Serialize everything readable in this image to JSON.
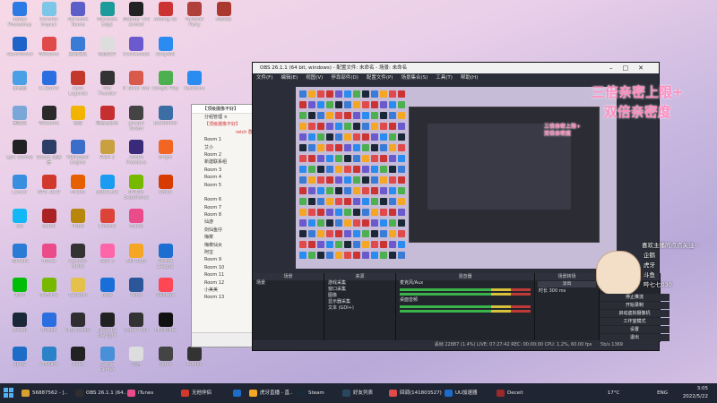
{
  "desktop": {
    "icons": [
      {
        "label": "Adobe Photoshop",
        "color": "#2c7be5"
      },
      {
        "label": "Genshin Impact",
        "color": "#7cc6e8"
      },
      {
        "label": "Microsoft Teams",
        "color": "#5b5fc7"
      },
      {
        "label": "Microsoft Edge",
        "color": "#1d9a9a"
      },
      {
        "label": "Nobody The Armed",
        "color": "#222"
      },
      {
        "label": "Among Us",
        "color": "#c33"
      },
      {
        "label": "Pummel Party",
        "color": "#b0403a"
      },
      {
        "label": "Honkai",
        "color": "#aa3a2f"
      },
      {
        "label": "TeamViewer",
        "color": "#1e64c8"
      },
      {
        "label": "WeGame",
        "color": "#e14a4a"
      },
      {
        "label": "腾讯会议",
        "color": "#3a7bd5"
      },
      {
        "label": "新建文件",
        "color": "#ddd"
      },
      {
        "label": "Overcooked",
        "color": "#6a5acd"
      },
      {
        "label": "DingTalk",
        "color": "#2a8cf0"
      },
      {
        "label": "",
        "color": "transparent"
      },
      {
        "label": "",
        "color": "transparent"
      },
      {
        "label": "此电脑",
        "color": "#4aa0e6"
      },
      {
        "label": "CCleaner",
        "color": "#2a6ee0"
      },
      {
        "label": "Apex Legends",
        "color": "#c0392b"
      },
      {
        "label": "War Thunder",
        "color": "#333"
      },
      {
        "label": "It Takes Two",
        "color": "#d75a4a"
      },
      {
        "label": "Google Play",
        "color": "#4caf50"
      },
      {
        "label": "Kuaishou",
        "color": "#2a8cf0"
      },
      {
        "label": "",
        "color": "transparent"
      },
      {
        "label": "回收站",
        "color": "#7aa7d8"
      },
      {
        "label": "WeGame",
        "color": "#2a2a2a"
      },
      {
        "label": "微信",
        "color": "#f1b400"
      },
      {
        "label": "网易云音乐",
        "color": "#c62f2f"
      },
      {
        "label": "Escape Tarkov",
        "color": "#444"
      },
      {
        "label": "Battlefield",
        "color": "#3a6ea5"
      },
      {
        "label": "",
        "color": "transparent"
      },
      {
        "label": "",
        "color": "transparent"
      },
      {
        "label": "Epic Games",
        "color": "#222"
      },
      {
        "label": "Steam 加速器",
        "color": "#2c3e66"
      },
      {
        "label": "Wallpaper Engine",
        "color": "#3a6ec8"
      },
      {
        "label": "Wish 3",
        "color": "#c8a040"
      },
      {
        "label": "Adobe Premiere",
        "color": "#3a2b7a"
      },
      {
        "label": "Origin",
        "color": "#f26522"
      },
      {
        "label": "",
        "color": "transparent"
      },
      {
        "label": "",
        "color": "transparent"
      },
      {
        "label": "Lancer",
        "color": "#3a8ee0"
      },
      {
        "label": "WPS 2019",
        "color": "#d0392b"
      },
      {
        "label": "Firefox",
        "color": "#e66000"
      },
      {
        "label": "Battle.net",
        "color": "#1a9cf0"
      },
      {
        "label": "NVIDIA Experience",
        "color": "#76b900"
      },
      {
        "label": "Office",
        "color": "#d83b01"
      },
      {
        "label": "",
        "color": "transparent"
      },
      {
        "label": "",
        "color": "transparent"
      },
      {
        "label": "QQ",
        "color": "#12b7f5"
      },
      {
        "label": "Game",
        "color": "#aa2222"
      },
      {
        "label": "PUBG",
        "color": "#b8860b"
      },
      {
        "label": "Chrome",
        "color": "#db4437"
      },
      {
        "label": "iTunes",
        "color": "#ea4c89"
      },
      {
        "label": "",
        "color": "transparent"
      },
      {
        "label": "",
        "color": "transparent"
      },
      {
        "label": "",
        "color": "transparent"
      },
      {
        "label": "Tencent",
        "color": "#2a7bd5"
      },
      {
        "label": "iTunes",
        "color": "#ea4c89"
      },
      {
        "label": "Counter-Strike",
        "color": "#333"
      },
      {
        "label": "osu! 3",
        "color": "#ff66aa"
      },
      {
        "label": "Fall Guys",
        "color": "#f5a623"
      },
      {
        "label": "Rocket League",
        "color": "#1c6fd1"
      },
      {
        "label": "",
        "color": "transparent"
      },
      {
        "label": "",
        "color": "transparent"
      },
      {
        "label": "iQIYI",
        "color": "#00be06"
      },
      {
        "label": "GeForce",
        "color": "#76b900"
      },
      {
        "label": "Genshin",
        "color": "#e4c14a"
      },
      {
        "label": "Tools",
        "color": "#1a6ed8"
      },
      {
        "label": "Word",
        "color": "#2b579a"
      },
      {
        "label": "Valorant",
        "color": "#ff4655"
      },
      {
        "label": "",
        "color": "transparent"
      },
      {
        "label": "",
        "color": "transparent"
      },
      {
        "label": "Steam",
        "color": "#1b2838"
      },
      {
        "label": "Ubisoft",
        "color": "#2a6ee0"
      },
      {
        "label": "OBS Studio",
        "color": "#302e31"
      },
      {
        "label": "Dead by Daylight",
        "color": "#222"
      },
      {
        "label": "Super Wolf",
        "color": "#333"
      },
      {
        "label": "MKOnline",
        "color": "#111"
      },
      {
        "label": "",
        "color": "transparent"
      },
      {
        "label": "",
        "color": "transparent"
      },
      {
        "label": "Uplay",
        "color": "#1d6cc8"
      },
      {
        "label": "VMware",
        "color": "#2a82c8"
      },
      {
        "label": "Geek",
        "color": "#222"
      },
      {
        "label": "Game Center",
        "color": "#4a90d9"
      },
      {
        "label": "文档",
        "color": "#ddd"
      },
      {
        "label": "Video",
        "color": "#444"
      },
      {
        "label": "Roblox",
        "color": "#333"
      },
      {
        "label": "",
        "color": "transparent"
      }
    ]
  },
  "chat": {
    "title": "【顶级摄像不好】",
    "header": "【顶级摄像不好】",
    "room_label": "分组管理 ×",
    "owner": "relch 群",
    "rows": [
      "Room 1",
      "艾小",
      "Room 2",
      "新建联系组",
      "Room 3",
      "Room 4",
      "Room 5",
      "",
      "Room 6",
      "Room 7",
      "Room 8",
      "仙游",
      "剑仙鱼仔",
      "梅菜",
      "梅菜仙女",
      "阿宝",
      "Room 9",
      "Room 10",
      "Room 11",
      "Room 12",
      "小美美",
      "Room 13"
    ]
  },
  "obs": {
    "title": "OBS 26.1.1 (64 bit, windows) - 配置文件: 未命名 - 场景: 未命名",
    "menu": [
      "文件(F)",
      "编辑(E)",
      "视图(V)",
      "停靠部件(D)",
      "配置文件(P)",
      "场景集合(S)",
      "工具(T)",
      "帮助(H)"
    ],
    "docks": {
      "scenes": {
        "header": "场景",
        "items": [
          "场景"
        ]
      },
      "sources": {
        "header": "来源",
        "items": [
          "游戏采集",
          "窗口采集",
          "图像",
          "显示器采集",
          "文本 (GDI+)"
        ]
      },
      "mixer": {
        "header": "混音器",
        "items": [
          "麦克风/Aux",
          "桌面音频"
        ],
        "levels": [
          "0.0 dB",
          "0.0 dB"
        ]
      },
      "transitions": {
        "header": "场景转场",
        "type": "淡出",
        "duration_label": "时长",
        "duration": "300 ms"
      },
      "controls": {
        "header": "控件",
        "buttons": [
          "停止推流",
          "开始录制",
          "启动虚拟摄像机",
          "工作室模式",
          "设置",
          "退出"
        ]
      }
    },
    "status": "丢帧 22887 (1.4%)   LIVE: 07:27:42   REC: 00:00:00   CPU: 1.2%, 60.00 fps",
    "bitrate": "5b/s 1369"
  },
  "stream_overlay": {
    "line1": "三倍亲密上限+",
    "line2": "双倍亲密度",
    "preview_line1": "三倍亲密上限+",
    "preview_line2": "双倍亲密度",
    "follow_text": "喜欢主播的点点关注~",
    "platform_names": [
      "企鹅",
      "虎牙",
      "斗鱼",
      "哔七七030"
    ]
  },
  "taskbar": {
    "items": [
      {
        "label": "56887562 - [..",
        "color": "#d8a030"
      },
      {
        "label": "OBS 26.1.1 (64..",
        "color": "#302e31"
      },
      {
        "label": "iTunes",
        "color": "#ea4c89"
      },
      {
        "label": "无他伴侣",
        "color": "#d0392b"
      },
      {
        "label": "",
        "color": "#1d6cc8"
      },
      {
        "label": "虎牙直播 - 直..",
        "color": "#f5a623"
      },
      {
        "label": "Steam",
        "color": "#1b2838"
      },
      {
        "label": "好友列表",
        "color": "#2a475e"
      },
      {
        "label": "回调(141803527)",
        "color": "#e14a4a"
      },
      {
        "label": "UU加速器",
        "color": "#1d6cc8"
      },
      {
        "label": "Deceit",
        "color": "#9a2a2a"
      }
    ],
    "weather": "17°C",
    "lang": "ENG",
    "time": "3:05",
    "date": "2022/5/22"
  }
}
